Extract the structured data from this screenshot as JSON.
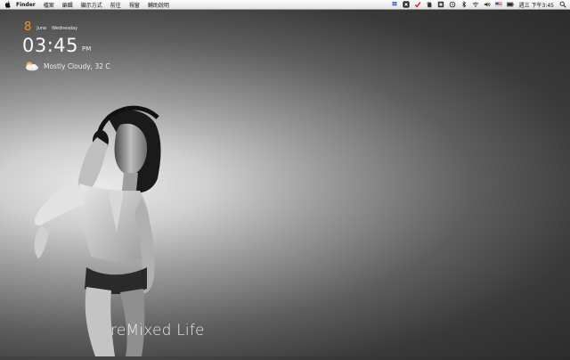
{
  "menubar": {
    "app_name": "Finder",
    "items": [
      "檔案",
      "編輯",
      "顯示方式",
      "前往",
      "視窗",
      "輔助說明"
    ],
    "clock": "週三 下午3:45",
    "tray_icons": [
      "dropbox-icon",
      "x-app-icon",
      "checkmark-icon",
      "evernote-icon",
      "growl-icon",
      "time-machine-icon",
      "bluetooth-icon",
      "wifi-icon",
      "volume-icon",
      "flag-icon",
      "battery-icon"
    ]
  },
  "widget": {
    "day": "8",
    "month": "June",
    "weekday": "Wednesday",
    "time": "03:45",
    "ampm": "PM",
    "weather": "Mostly Cloudy, 32 C"
  },
  "wallpaper": {
    "caption": "reMixed Life"
  },
  "colors": {
    "accent": "#f7941d",
    "menubar_bg": "#ececec"
  }
}
